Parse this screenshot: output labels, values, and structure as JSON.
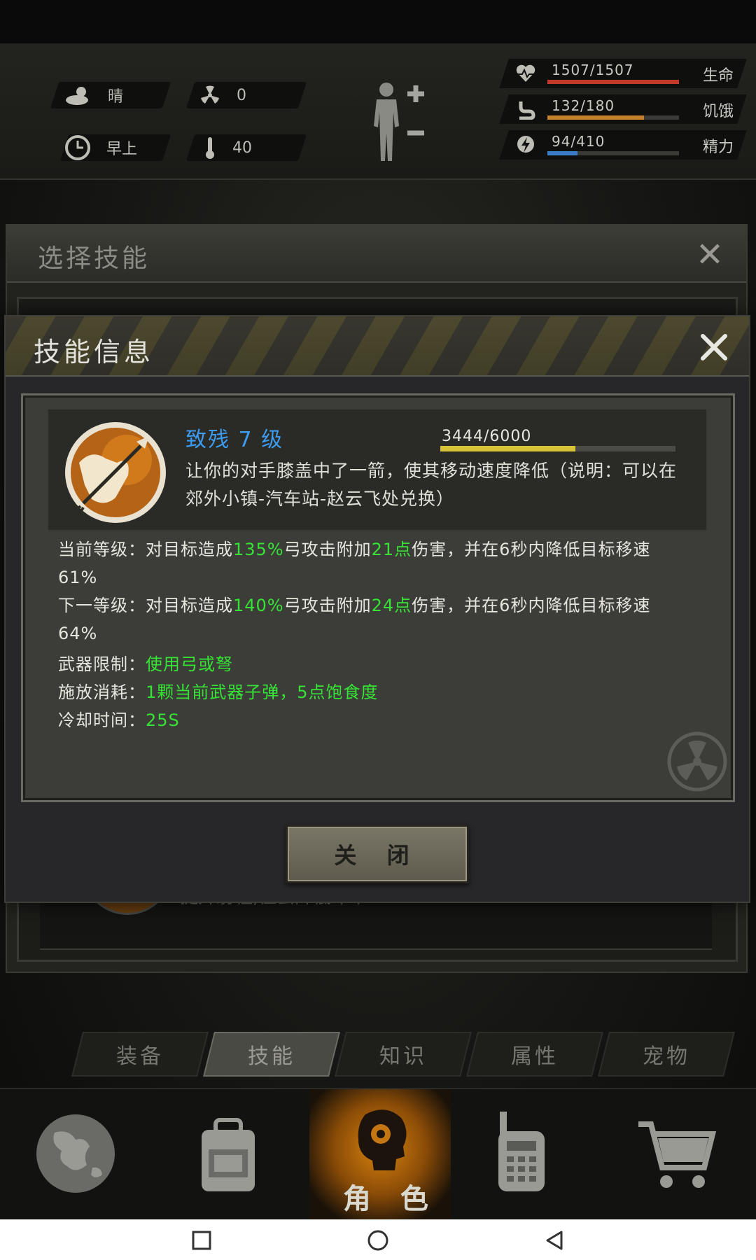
{
  "hud": {
    "weather": "晴",
    "radiation": "0",
    "time_of_day": "早上",
    "temperature": "40",
    "stats": [
      {
        "value": "1507/1507",
        "label": "生命",
        "fill": 1.0,
        "color": "#c23a2a"
      },
      {
        "value": "132/180",
        "label": "饥饿",
        "fill": 0.733,
        "color": "#c6822a"
      },
      {
        "value": "94/410",
        "label": "精力",
        "fill": 0.229,
        "color": "#3a7ec8"
      }
    ]
  },
  "background_dialog": {
    "title": "选择技能",
    "list_text": "提升射程,但会降低命中"
  },
  "dialog": {
    "title": "技能信息",
    "skill": {
      "name": "致残 7 级",
      "exp": "3444/6000",
      "exp_fraction": 0.574,
      "description": "让你的对手膝盖中了一箭，使其移动速度降低（说明：可以在郊外小镇-汽车站-赵云飞处兑换）"
    },
    "current_level": {
      "prefix": "当前等级：对目标造成",
      "pct": "135%",
      "mid": "弓攻击附加",
      "points": "21点",
      "suffix": "伤害，并在6秒内降低目标移速61%"
    },
    "next_level": {
      "prefix": "下一等级：对目标造成",
      "pct": "140%",
      "mid": "弓攻击附加",
      "points": "24点",
      "suffix": "伤害，并在6秒内降低目标移速64%"
    },
    "weapon_limit": {
      "label": "武器限制：",
      "value": "使用弓或弩"
    },
    "cost": {
      "label": "施放消耗：",
      "value": "1颗当前武器子弹，5点饱食度"
    },
    "cooldown": {
      "label": "冷却时间：",
      "value": "25S"
    },
    "close_button": "关 闭"
  },
  "tabs": [
    "装备",
    "技能",
    "知识",
    "属性",
    "宠物"
  ],
  "active_tab": "技能",
  "bottom_nav": {
    "items": [
      "globe-icon",
      "backpack-icon",
      "character-icon",
      "radio-icon",
      "cart-icon"
    ],
    "active_label": "角 色"
  },
  "colors": {
    "accent_green": "#35e435",
    "skill_name_blue": "#3c9cf0",
    "nav_active_orange": "#d7820e"
  }
}
